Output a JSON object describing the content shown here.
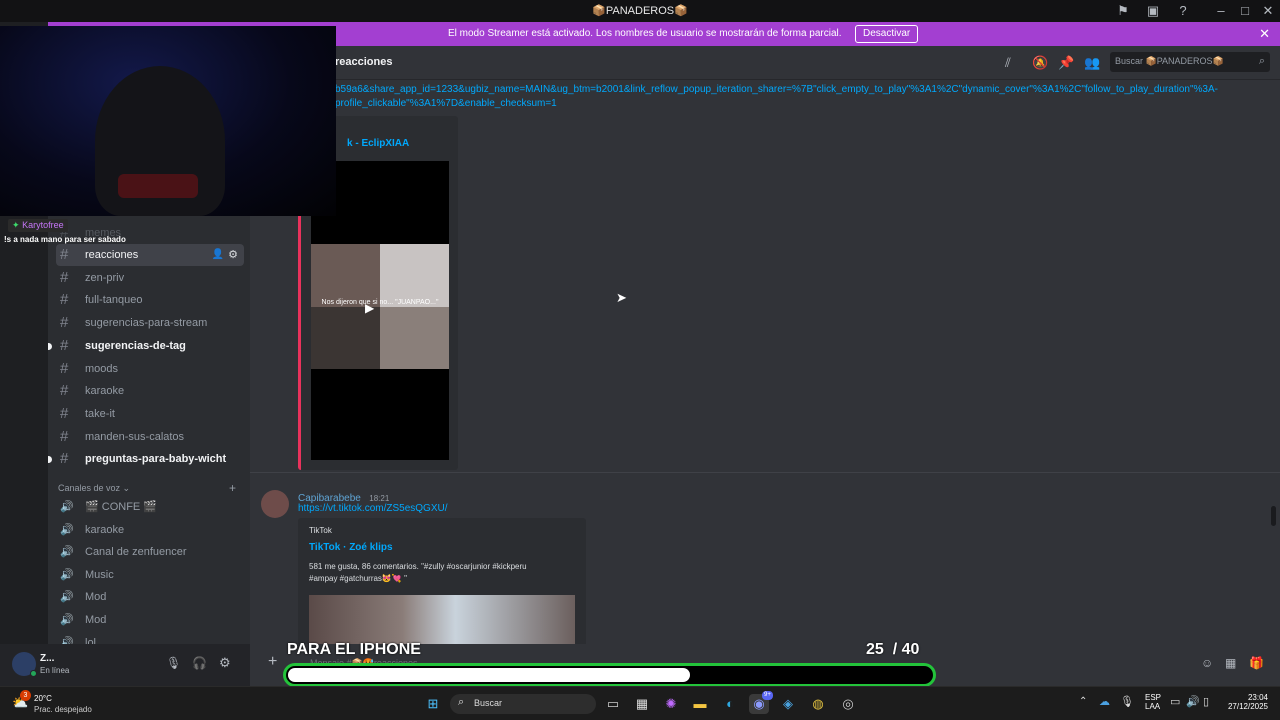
{
  "window": {
    "title": "📦PANADEROS📦"
  },
  "banner": {
    "message": "El modo Streamer está activado. Los nombres de usuario se mostrarán de forma parcial.",
    "button": "Desactivar"
  },
  "overlay": {
    "username": "Karytofree",
    "chat_text": "!s a nada mano para ser sabado",
    "faded_channel": "memes"
  },
  "sidebar": {
    "channels": [
      {
        "name": "reacciones",
        "state": "active"
      },
      {
        "name": "zen-priv",
        "state": "normal"
      },
      {
        "name": "full-tanqueo",
        "state": "normal"
      },
      {
        "name": "sugerencias-para-stream",
        "state": "normal"
      },
      {
        "name": "sugerencias-de-tag",
        "state": "unread"
      },
      {
        "name": "moods",
        "state": "normal"
      },
      {
        "name": "karaoke",
        "state": "normal"
      },
      {
        "name": "take-it",
        "state": "normal"
      },
      {
        "name": "manden-sus-calatos",
        "state": "normal"
      },
      {
        "name": "preguntas-para-baby-wicht",
        "state": "unread"
      }
    ],
    "voice_category": "Canales de voz",
    "voice_channels": [
      {
        "name": "🎬 CONFE 🎬"
      },
      {
        "name": "karaoke"
      },
      {
        "name": "Canal de zenfuencer"
      },
      {
        "name": "Music"
      },
      {
        "name": "Mod"
      },
      {
        "name": "Mod"
      },
      {
        "name": "lol"
      }
    ]
  },
  "header": {
    "channel_name": "reacciones",
    "search_placeholder": "Buscar 📦PANADEROS📦"
  },
  "chat": {
    "url_line1": "b59a6&share_app_id=1233&ugbiz_name=MAIN&ug_btm=b2001&link_reflow_popup_iteration_sharer=%7B\"click_empty_to_play\"%3A1%2C\"dynamic_cover\"%3A1%2C\"follow_to_play_duration\"%3A-",
    "url_line2": "profile_clickable\"%3A1%7D&enable_checksum=1",
    "embed1_title": "k - EclipXIAA",
    "video_caption": "Nos dijeron que si no... \"JUANPAO...\"",
    "author": "Capibarabebe",
    "time": "18:21",
    "link": "https://vt.tiktok.com/ZS5esQGXU/",
    "embed2_provider": "TikTok",
    "embed2_title": "TikTok · Zoé klips",
    "embed2_desc_line1": "581 me gusta, 86 comentarios. \"#zully #oscarjunior #kickperu",
    "embed2_desc_line2": "#ampay #gatchurras😻💘 \""
  },
  "user": {
    "name": "Z...",
    "status": "En línea"
  },
  "composer": {
    "placeholder": "Mensaje #📦🥵reacciones"
  },
  "goal": {
    "label": "PARA EL IPHONE",
    "current": "25",
    "total": "/ 40",
    "progress": 0.625,
    "color": "#23c33a"
  },
  "taskbar": {
    "temperature": "20°C",
    "weather": "Prac. despejado",
    "weather_badge": "3",
    "search": "Buscar",
    "lang": "ESP",
    "region": "LAA",
    "time": "23:04",
    "date": "27/12/2025",
    "discord_badge": "9+"
  }
}
